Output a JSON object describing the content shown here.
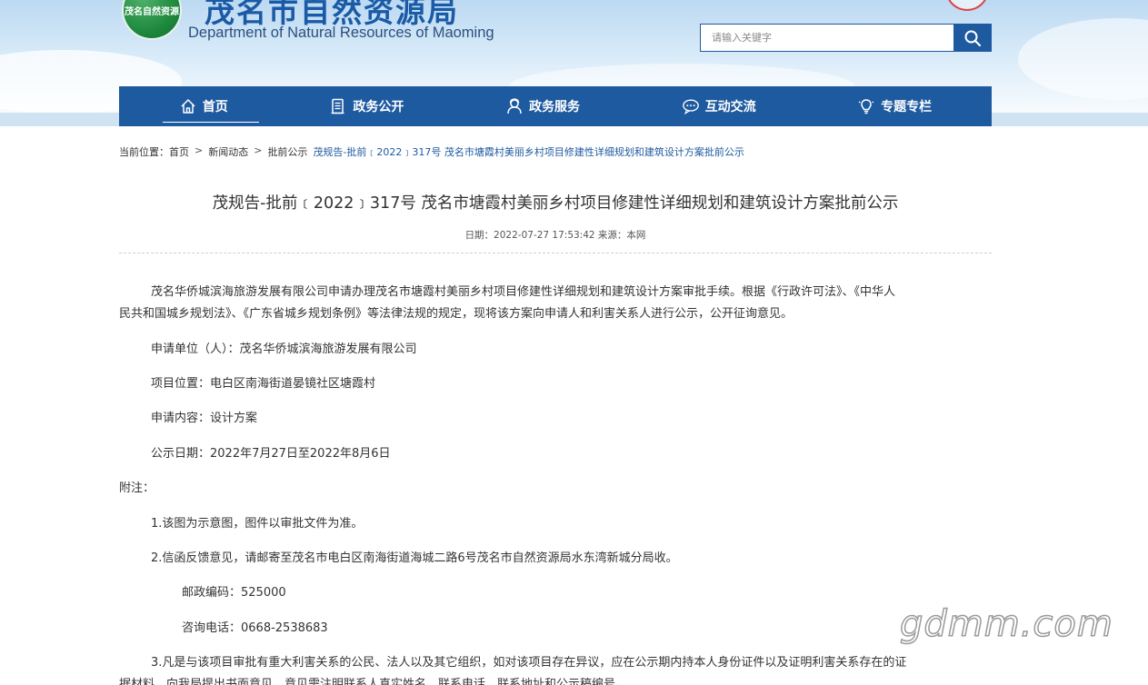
{
  "header": {
    "logo_badge_text": "茂名自然资源",
    "title": "茂名市自然资源局",
    "subtitle": "Department of Natural Resources of Maoming"
  },
  "search": {
    "placeholder": "请输入关键字",
    "icon": "search-icon"
  },
  "nav": {
    "items": [
      {
        "label": "首页",
        "icon": "home-icon"
      },
      {
        "label": "政务公开",
        "icon": "document-icon"
      },
      {
        "label": "政务服务",
        "icon": "service-person-icon"
      },
      {
        "label": "互动交流",
        "icon": "chat-bubble-icon"
      },
      {
        "label": "专题专栏",
        "icon": "lightbulb-icon"
      }
    ],
    "active_index": 0
  },
  "breadcrumb": {
    "label": "当前位置：",
    "items": [
      "首页",
      "新闻动态",
      "批前公示",
      "茂规告-批前﹝2022﹞317号 茂名市塘霞村美丽乡村项目修建性详细规划和建筑设计方案批前公示"
    ],
    "separator": ">"
  },
  "article": {
    "title": "茂规告-批前﹝2022﹞317号 茂名市塘霞村美丽乡村项目修建性详细规划和建筑设计方案批前公示",
    "meta": "日期：2022-07-27 17:53:42  来源：本网",
    "intro_line1": "茂名华侨城滨海旅游发展有限公司申请办理茂名市塘霞村美丽乡村项目修建性详细规划和建筑设计方案审批手续。根据《行政许可法》、《中华人",
    "intro_line2": "民共和国城乡规划法》、《广东省城乡规划条例》等法律法规的规定，现将该方案向申请人和利害关系人进行公示，公开征询意见。",
    "applicant": "申请单位（人）：茂名华侨城滨海旅游发展有限公司",
    "location": "项目位置：电白区南海街道晏镜社区塘霞村",
    "content": "申请内容：设计方案",
    "period": "公示日期：2022年7月27日至2022年8月6日",
    "notes_label": "附注：",
    "note1": "1.该图为示意图，图件以审批文件为准。",
    "note2": "2.信函反馈意见，请邮寄至茂名市电白区南海街道海城二路6号茂名市自然资源局水东湾新城分局收。",
    "postcode": "邮政编码：525000",
    "phone": "咨询电话：0668-2538683",
    "note3_line1": "3.凡是与该项目审批有重大利害关系的公民、法人以及其它组织，如对该项目存在异议，应在公示期内持本人身份证件以及证明利害关系存在的证",
    "note3_line2": "据材料，向我局提出书面意见，意见需注明联系人真实姓名、联系电话、联系地址和公示稿编号。"
  },
  "watermark": "gdmm.com",
  "colors": {
    "primary": "#1e5aa0",
    "text": "#333333"
  }
}
